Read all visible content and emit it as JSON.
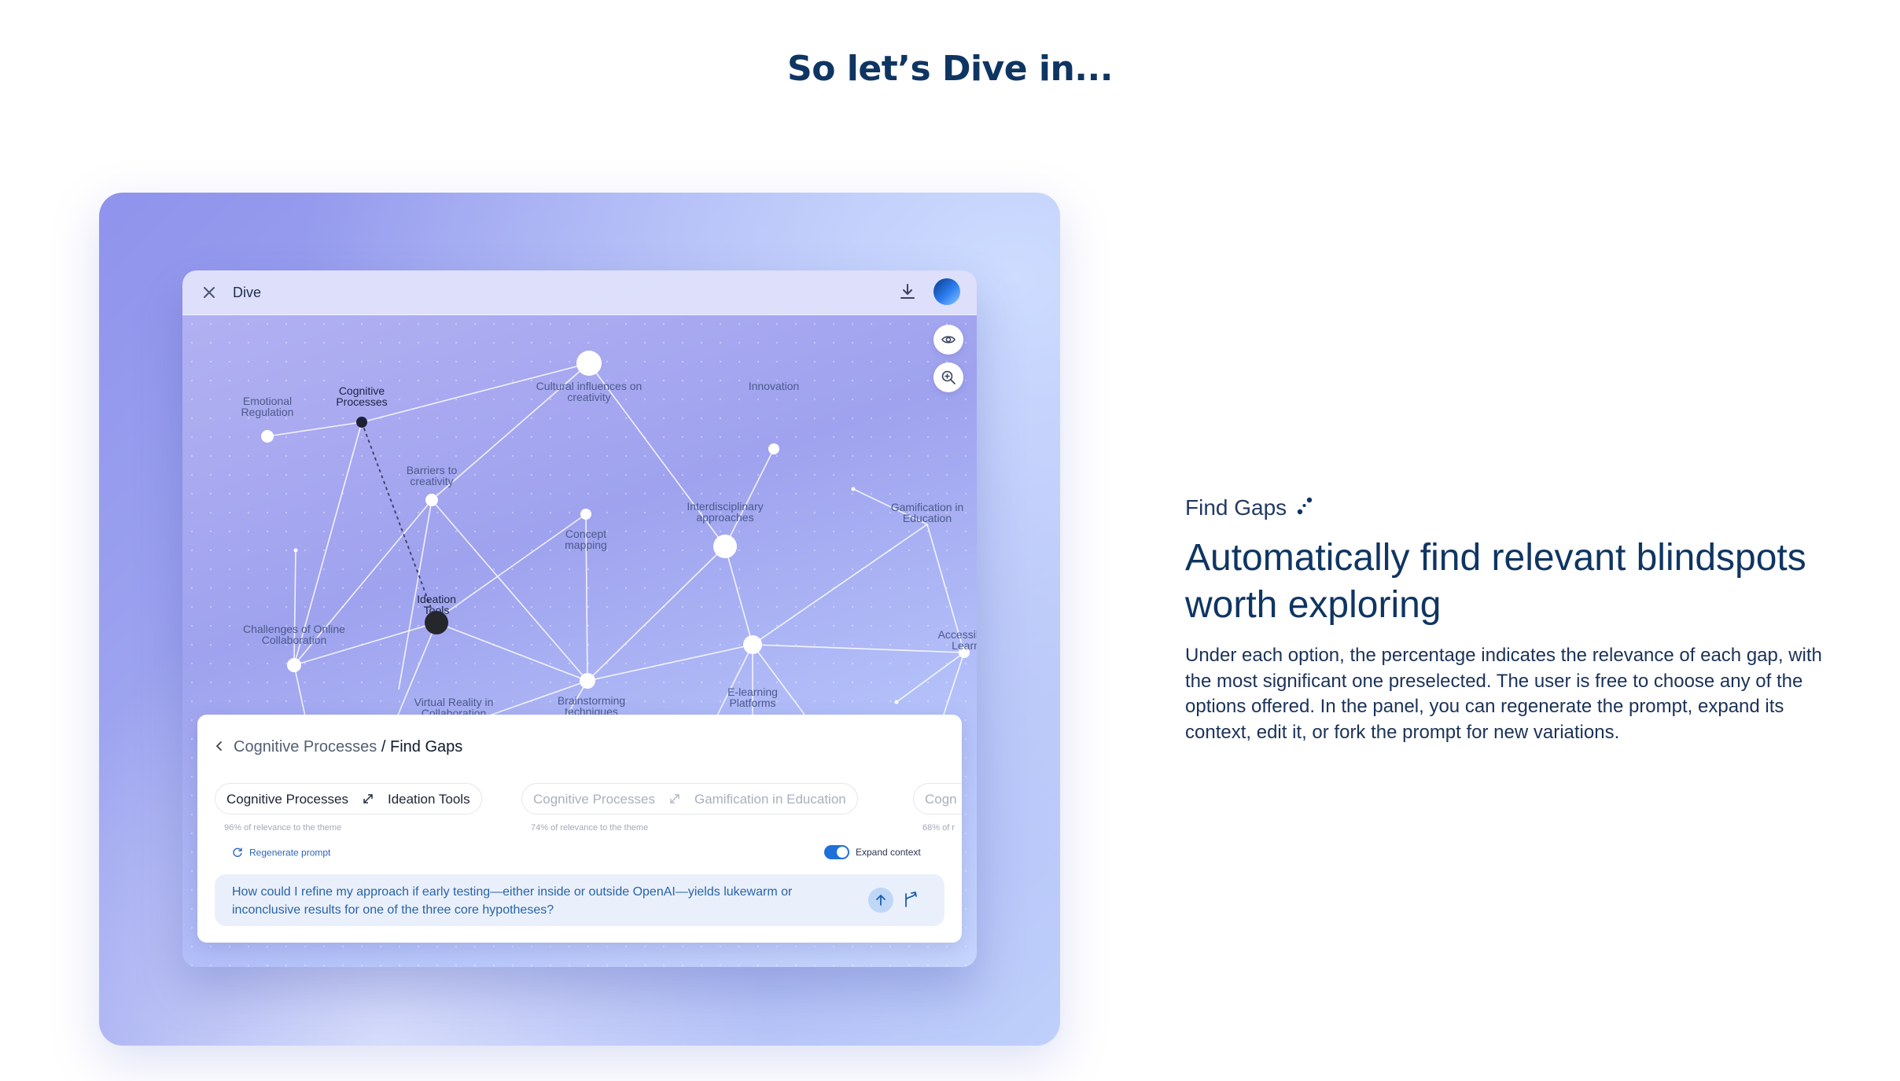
{
  "hero": {
    "title": "So let’s Dive in..."
  },
  "app": {
    "title": "Dive",
    "graph_nodes": {
      "emotional_regulation": "Emotional Regulation",
      "cognitive_processes": "Cognitive Processes",
      "cultural_influences": "Cultural influences on creativity",
      "innovation": "Innovation",
      "barriers": "Barriers to creativity",
      "interdisciplinary": "Interdisciplinary approaches",
      "gamification": "Gamification in Education",
      "concept_mapping": "Concept mapping",
      "challenges": "Challenges of Online Collaboration",
      "ideation_tools": "Ideation Tools",
      "accessibility": "Accessib in Learn",
      "virtual_reality": "Virtual Reality in Collaboration",
      "brainstorming": "Brainstorming techniques",
      "elearning": "E-learning Platforms"
    },
    "help_label": "?",
    "panel": {
      "breadcrumb_parent": "Cognitive Processes",
      "breadcrumb_sep": " / ",
      "breadcrumb_current": "Find Gaps",
      "options": [
        {
          "from": "Cognitive Processes",
          "to": "Ideation Tools",
          "relevance": "96% of relevance to the theme"
        },
        {
          "from": "Cognitive Processes",
          "to": "Gamification in Education",
          "relevance": "74% of relevance to the theme"
        },
        {
          "from": "Cogn",
          "relevance": "68% of r"
        }
      ],
      "regenerate_label": "Regenerate prompt",
      "expand_context_label": "Expand context",
      "expand_context_on": true,
      "prompt": "How could I refine my approach if early testing—either inside or outside OpenAI—yields lukewarm or inconclusive results for one of the three core hypotheses?"
    }
  },
  "feature": {
    "tag": "Find Gaps",
    "heading": "Automatically find relevant blindspots worth exploring",
    "body": "Under each option, the percentage indicates the relevance of each gap, with the most significant one preselected. The user is free to choose any of the options offered. In the panel, you can regenerate the prompt, expand its context, edit it, or fork the prompt for new variations."
  },
  "colors": {
    "brand_navy": "#0f3562",
    "accent_blue": "#1f70d8",
    "link_blue": "#2c66b6"
  }
}
